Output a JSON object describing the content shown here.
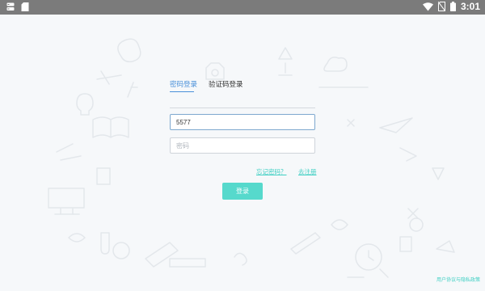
{
  "status_bar": {
    "time": "3:01",
    "left_icons": [
      "storage-icon",
      "sd-card-icon"
    ],
    "right_icons": [
      "wifi-icon",
      "no-sim-icon",
      "battery-icon"
    ]
  },
  "login": {
    "tabs": [
      {
        "label": "密码登录",
        "active": true
      },
      {
        "label": "验证码登录",
        "active": false
      }
    ],
    "phone_value": "5577",
    "password_placeholder": "密码",
    "forgot_password": "忘记密码？",
    "register": "去注册",
    "login_button": "登录"
  },
  "footer": {
    "agreement": "用户协议与隐私政策"
  },
  "colors": {
    "status_bar": "#7b7b7b",
    "accent_blue": "#4a90d9",
    "teal": "#56d9cc",
    "link_teal": "#3fcfc3",
    "background": "#f6f8fa"
  }
}
